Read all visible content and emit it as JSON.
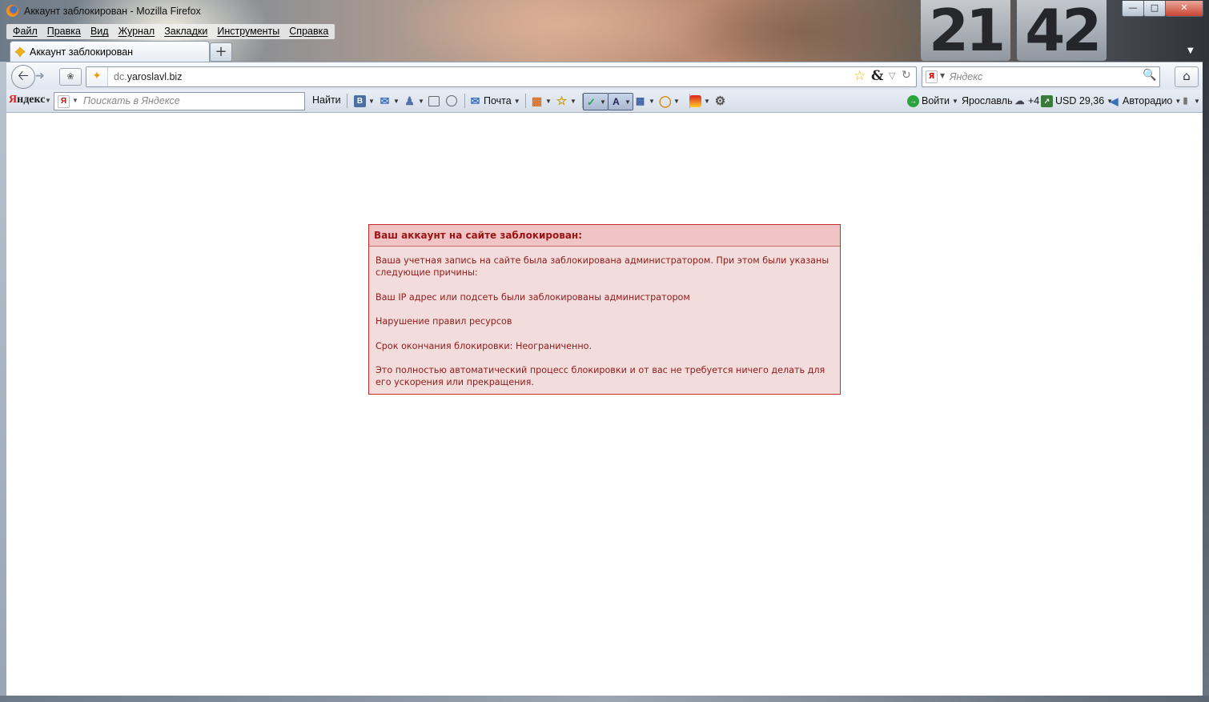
{
  "window": {
    "title": "Аккаунт заблокирован - Mozilla Firefox",
    "clock_hours": "21",
    "clock_minutes": "42"
  },
  "menu": [
    "Файл",
    "Правка",
    "Вид",
    "Журнал",
    "Закладки",
    "Инструменты",
    "Справка"
  ],
  "tab": {
    "label": "Аккаунт заблокирован",
    "new_tab": "+"
  },
  "nav": {
    "url_prefix": "dc.",
    "url_host": "yaroslavl.biz",
    "search_placeholder": "Яндекс",
    "search_logo": "Я"
  },
  "yandex_bar": {
    "brand_first": "Я",
    "brand_rest": "ндекс",
    "search_placeholder": "Поискать в Яндексе",
    "find_label": "Найти",
    "vk_badge": "B",
    "mail_label": "Почта",
    "login_label": "Войти",
    "city": "Ярославль",
    "weather": "+4",
    "currency": "USD 29,36",
    "radio": "Авторадио"
  },
  "ban": {
    "heading": "Ваш аккаунт на сайте заблокирован:",
    "intro": "Ваша учетная запись на сайте была заблокирована администратором. При этом были указаны следующие причины:",
    "reason_ip": "Ваш IP адрес или подсеть были заблокированы администратором",
    "reason_rules": "Нарушение правил ресурсов",
    "expiry": "Срок окончания блокировки: Неограниченно.",
    "note": "Это полностью автоматический процесс блокировки и от вас не требуется ничего делать для его ускорения или прекращения."
  },
  "colors": {
    "ban_border": "#c42b2b",
    "ban_background": "#f3dcdc",
    "ban_header_background": "#f0c4c4",
    "ban_text": "#8f1b1b"
  }
}
